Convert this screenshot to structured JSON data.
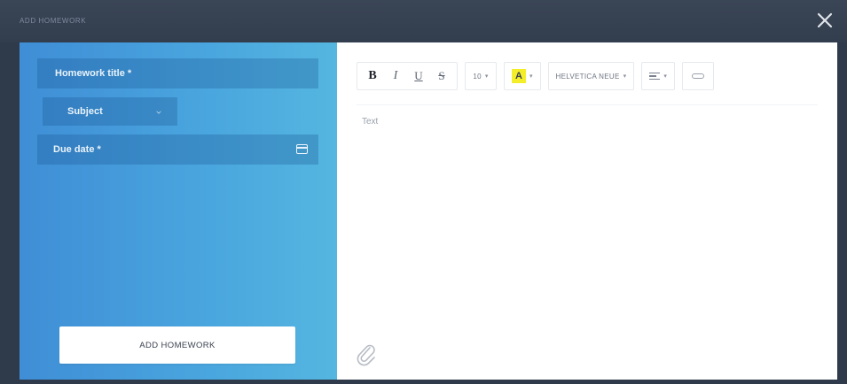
{
  "dialog": {
    "title": "ADD HOMEWORK",
    "close_icon": "close-icon"
  },
  "form": {
    "title_placeholder": "Homework title *",
    "subject_label": "Subject",
    "due_date_placeholder": "Due date *",
    "submit_label": "ADD HOMEWORK"
  },
  "toolbar": {
    "bold": "B",
    "italic": "I",
    "underline": "U",
    "strike": "S",
    "font_size": "10",
    "highlight": "A",
    "font_family": "HELVETICA NEUE",
    "align_icon": "align-left-icon",
    "link_icon": "link-icon",
    "highlight_color": "#f4ee2a"
  },
  "editor": {
    "placeholder": "Text"
  },
  "colors": {
    "panel_left": "#3f8ed6",
    "panel_right": "#55b6e0",
    "titlebar": "#323d4e"
  }
}
